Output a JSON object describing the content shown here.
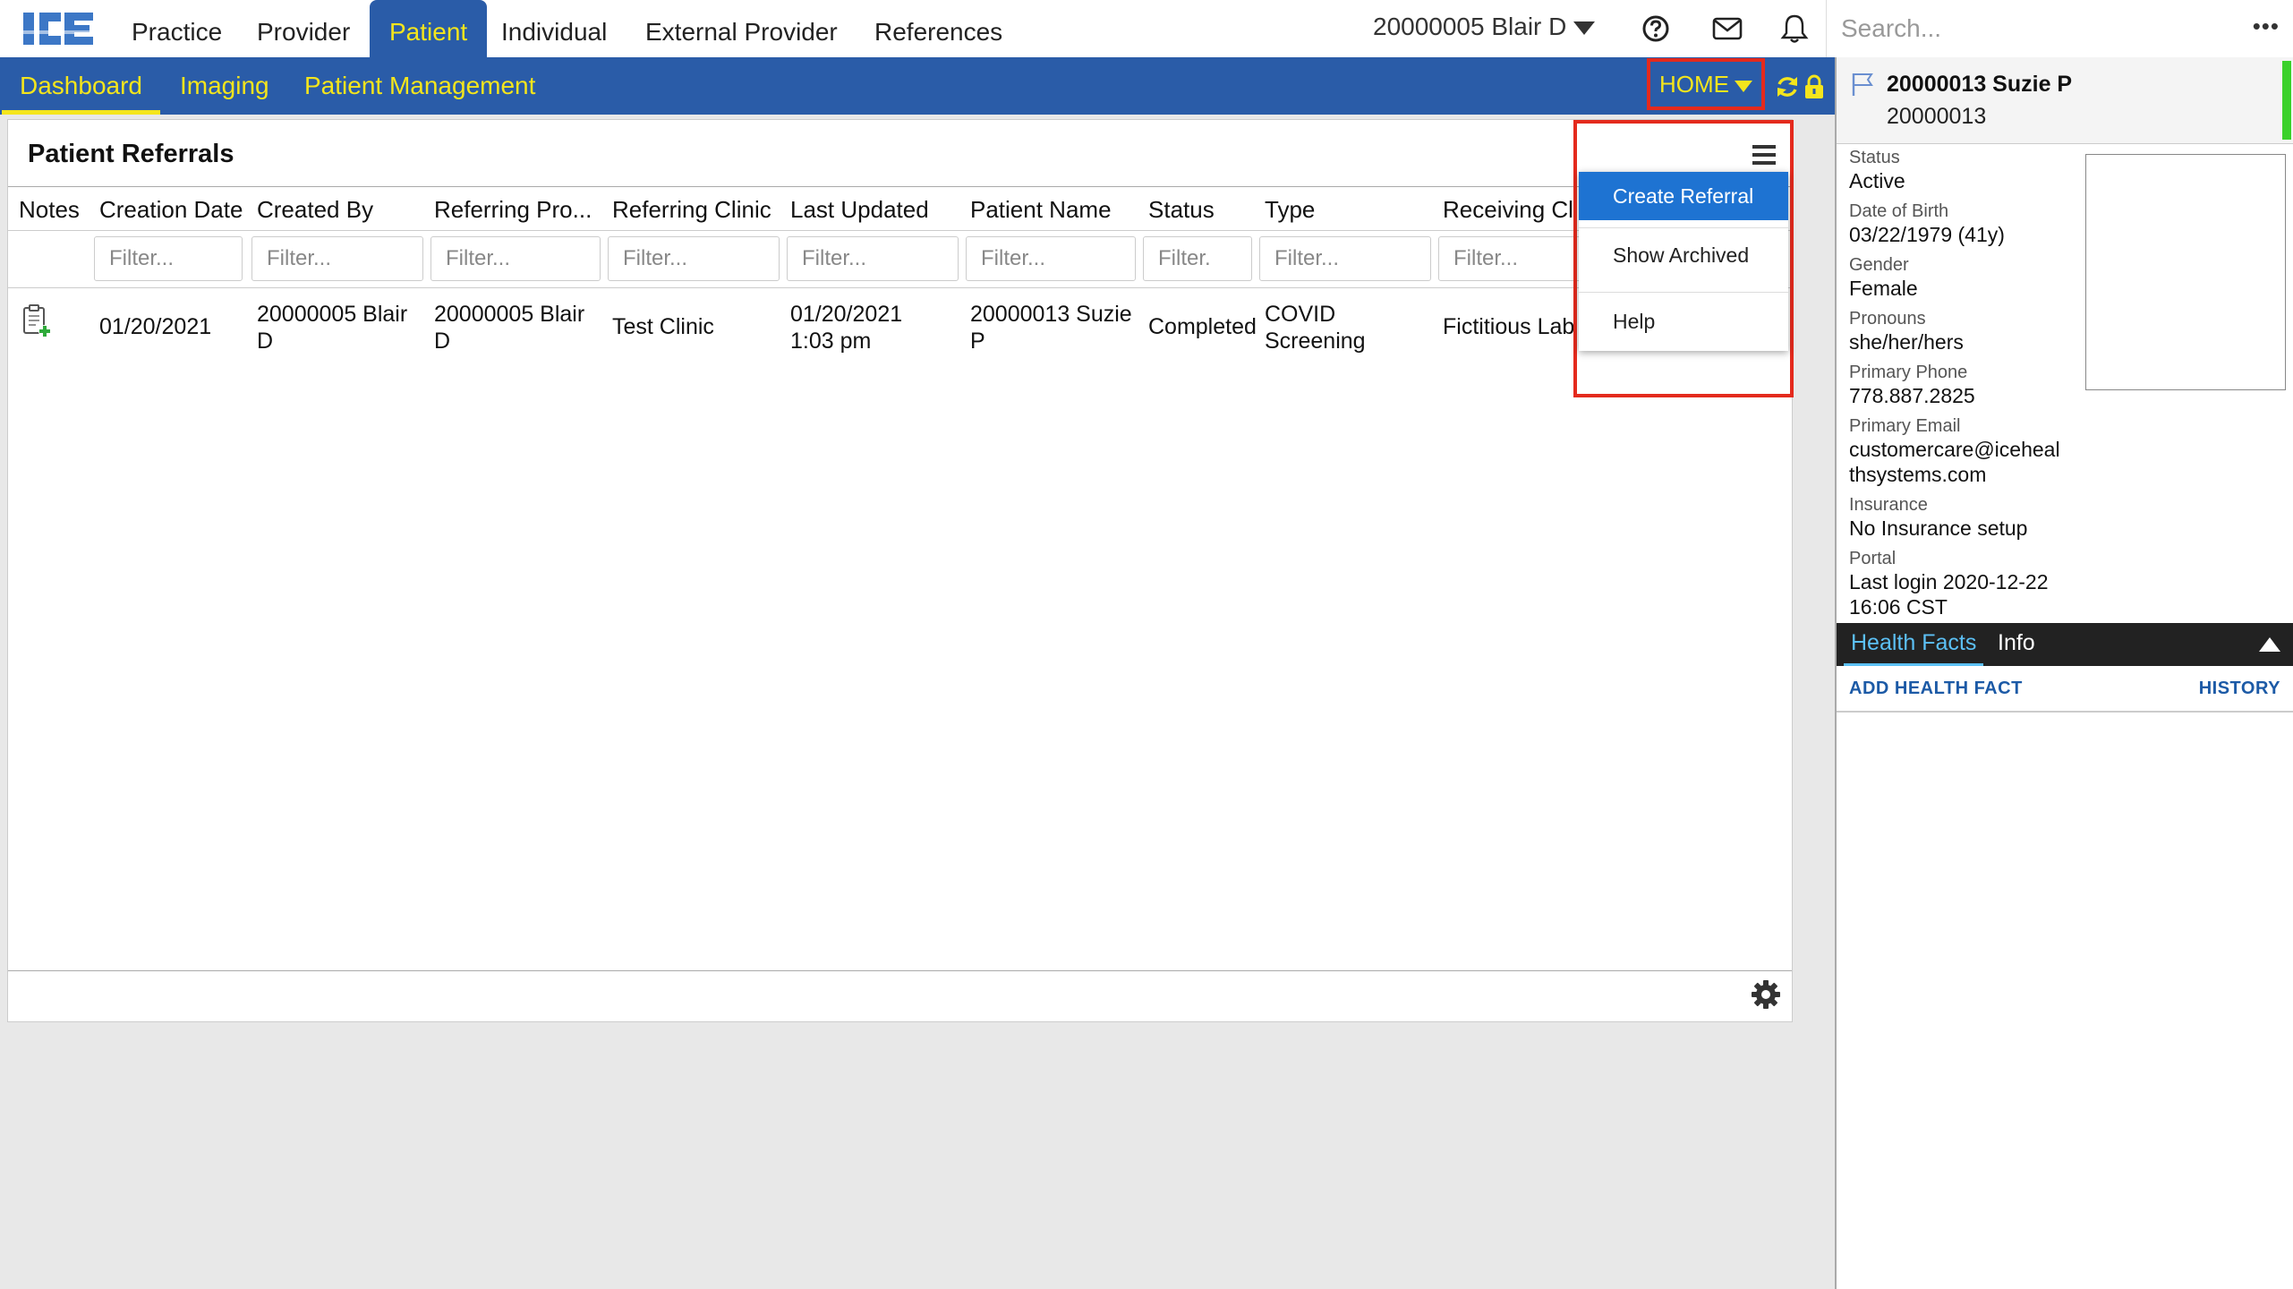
{
  "app": {
    "logo_text": "ICE"
  },
  "topnav": {
    "items": [
      "Practice",
      "Provider",
      "Patient",
      "Individual",
      "External Provider",
      "References"
    ],
    "active": "Patient"
  },
  "user": {
    "name": "20000005 Blair D"
  },
  "search": {
    "placeholder": "Search..."
  },
  "subnav": {
    "items": [
      "Dashboard",
      "Imaging",
      "Patient Management"
    ],
    "active": "Dashboard",
    "home_label": "HOME"
  },
  "panel": {
    "title": "Patient Referrals",
    "columns": [
      "Notes",
      "Creation Date",
      "Created By",
      "Referring Pro...",
      "Referring Clinic",
      "Last Updated",
      "Patient Name",
      "Status",
      "Type",
      "Receiving Clin"
    ],
    "filter_placeholders": [
      "Filter...",
      "Filter...",
      "Filter...",
      "Filter...",
      "Filter...",
      "Filter...",
      "Filter.",
      "Filter...",
      "Filter..."
    ],
    "rows": [
      {
        "creation_date": "01/20/2021",
        "created_by": [
          "20000005 Blair",
          "D"
        ],
        "referring_provider": [
          "20000005 Blair",
          "D"
        ],
        "referring_clinic": "Test Clinic",
        "last_updated": [
          "01/20/2021",
          "1:03 pm"
        ],
        "patient_name": [
          "20000013 Suzie",
          "P"
        ],
        "status": "Completed",
        "type": [
          "COVID",
          "Screening"
        ],
        "receiving_clinic": "Fictitious Lab"
      }
    ]
  },
  "dropdown": {
    "items": [
      "Create Referral",
      "Show Archived",
      "Help"
    ],
    "selected": "Create Referral"
  },
  "patient": {
    "name": "20000013 Suzie P",
    "id": "20000013",
    "fields": [
      {
        "label": "Status",
        "value": "Active"
      },
      {
        "label": "Date of Birth",
        "value": "03/22/1979 (41y)"
      },
      {
        "label": "Gender",
        "value": "Female"
      },
      {
        "label": "Pronouns",
        "value": "she/her/hers"
      },
      {
        "label": "Primary Phone",
        "value": "778.887.2825"
      },
      {
        "label": "Primary Email",
        "value": "customercare@icehealthsystems.com"
      },
      {
        "label": "Insurance",
        "value": "No Insurance setup"
      },
      {
        "label": "Portal",
        "value": "Last login 2020-12-22 16:06 CST"
      }
    ],
    "tabs": [
      "Health Facts",
      "Info"
    ],
    "active_tab": "Health Facts",
    "add_health_fact": "ADD HEALTH FACT",
    "history": "HISTORY"
  },
  "colors": {
    "brand_blue": "#2a5ca8",
    "nav_yellow": "#f4e51c",
    "highlight_red": "#e42a1d",
    "selected_blue": "#1e73d2",
    "status_green": "#3ad12a"
  }
}
